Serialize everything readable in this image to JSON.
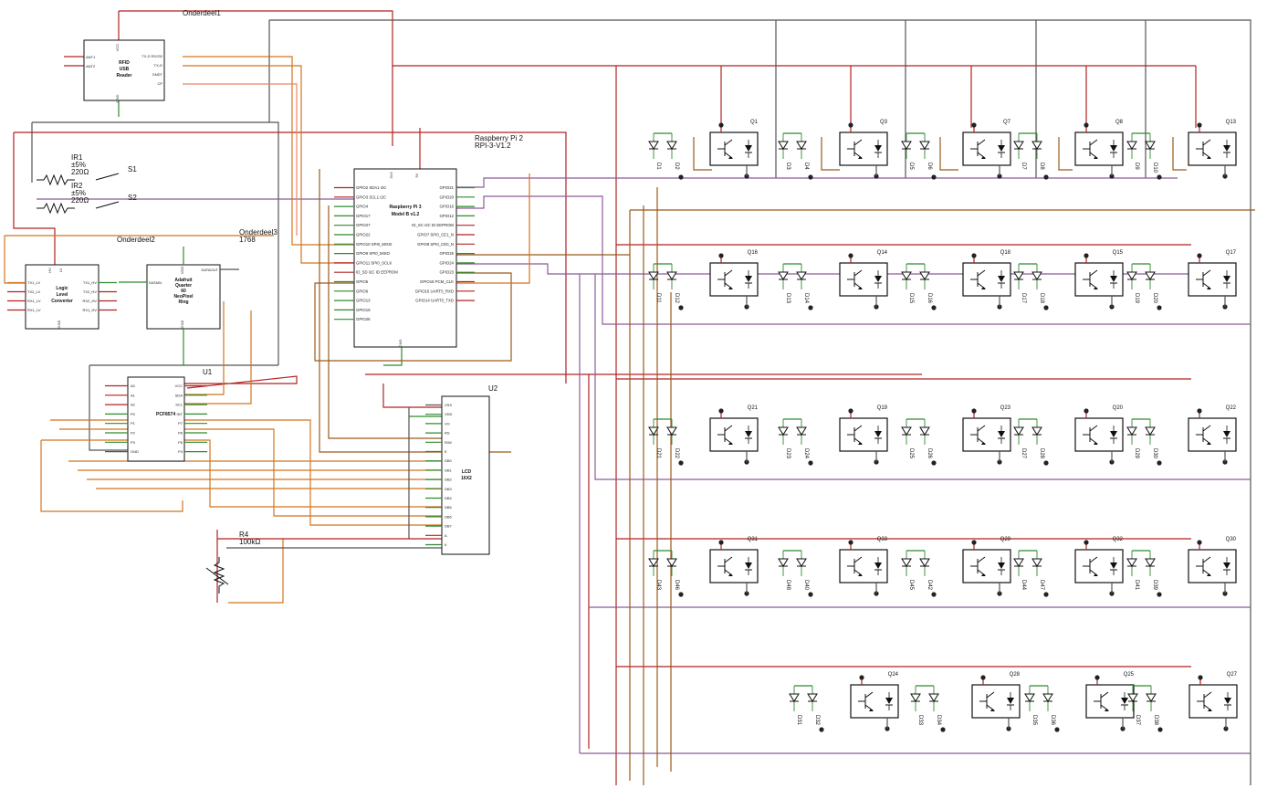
{
  "colors": {
    "red": "#b22222",
    "green": "#2e8b2e",
    "gray": "#555555",
    "brown": "#9a5a1c",
    "orange": "#d2751e",
    "purple": "#8e5b9a",
    "salmon": "#e8876a"
  },
  "labels": {
    "onderdeel1": "Onderdeel1",
    "onderdeel2": "Onderdeel2",
    "onderdeel3": "Onderdeel3",
    "onderdeel3_value": "1768",
    "rpi_title": "Raspberry Pi 2",
    "rpi_model": "RPI-3-V1.2",
    "u1": "U1",
    "u2": "U2",
    "ir1": "IR1",
    "ir2": "IR2",
    "tol": "±5%",
    "ohm": "220Ω",
    "s1": "S1",
    "s2": "S2",
    "r4": "R4",
    "r4_value": "100kΩ"
  },
  "chips": {
    "rfid": {
      "lines": [
        "RFID",
        "USB",
        "Reader"
      ],
      "vcc": "VCC",
      "gnd": "GND",
      "left_pins": [
        "ANT1",
        "ANT2"
      ],
      "right_pins": [
        "TX-D RX232",
        "TX-D",
        "GNDT",
        "CP"
      ]
    },
    "rpi": {
      "lines": [
        "Raspberry Pi 3",
        "Model B v1.2"
      ],
      "top_pins": [
        "3V3",
        "5V"
      ],
      "gnd": "GND",
      "left_pins": [
        "GPIO2 SDA1 I2C",
        "GPIO3 SCL1 I2C",
        "GPIO4",
        "GPIO17",
        "GPIO27",
        "GPIO22",
        "GPIO10 SPI0_MOSI",
        "GPIO9 SPI0_MISO",
        "GPIO11 SPI0_SCLK",
        "ID_SD I2C ID EEPROM",
        "GPIO5",
        "GPIO6",
        "GPIO13",
        "GPIO19",
        "GPIO26"
      ],
      "right_pins": [
        "GPIO21",
        "GPIO20",
        "GPIO16",
        "GPIO12",
        "ID_SC I2C ID EEPROM",
        "GPIO7 SPI0_CE1_N",
        "GPIO8 SPI0_CE0_N",
        "GPIO25",
        "GPIO24",
        "GPIO23",
        "GPIO18 PCM_CLK",
        "GPIO15 UART0_RXD",
        "GPIO14 UART0_TXD"
      ]
    },
    "llc": {
      "lines": [
        "Logic",
        "Level",
        "Converter"
      ],
      "top_pins": [
        "HV",
        "LV"
      ],
      "gnd": "GND",
      "left_pins": [
        "TX1_LV",
        "TX2_LV",
        "RX1_LV",
        "RX1_LV"
      ],
      "right_pins": [
        "TX1_HV",
        "TX2_HV",
        "RX2_HV",
        "RX1_HV"
      ]
    },
    "neo": {
      "lines": [
        "Adafruit",
        "Quarter",
        "60",
        "NeoPixel",
        "Ring"
      ],
      "vcc": "VDD",
      "gnd": "GND",
      "din": "DATAIN",
      "dout": "DATAOUT"
    },
    "pcf": {
      "lines": [
        "PCF8574"
      ],
      "left_pins": [
        "A0",
        "A1",
        "A2",
        "P0",
        "P1",
        "P2",
        "P3",
        "GND"
      ],
      "right_pins": [
        "VCC",
        "SDA",
        "SCL",
        "INT",
        "P7",
        "P6",
        "P5",
        "P4"
      ]
    },
    "lcd": {
      "lines": [
        "LCD",
        "16X2"
      ],
      "pins": [
        "VSS",
        "VDD",
        "VO",
        "RS",
        "R/W",
        "E",
        "DB0",
        "DB1",
        "DB2",
        "DB3",
        "DB4",
        "DB5",
        "DB6",
        "DB7",
        "A",
        "K"
      ]
    }
  },
  "transistor_rows": [
    [
      "Q1",
      "Q3",
      "Q7",
      "Q8",
      "Q13"
    ],
    [
      "Q16",
      "Q14",
      "Q18",
      "Q15",
      "Q17"
    ],
    [
      "Q21",
      "Q19",
      "Q23",
      "Q20",
      "Q22"
    ],
    [
      "Q31",
      "Q33",
      "Q29",
      "Q32",
      "Q30"
    ],
    [
      "Q24",
      "Q28",
      "Q25",
      "Q27"
    ]
  ],
  "diode_rows": [
    [
      "D1",
      "D2",
      "D3",
      "D4",
      "D5",
      "D6",
      "D7",
      "D8",
      "D9",
      "D10"
    ],
    [
      "D11",
      "D12",
      "D13",
      "D14",
      "D15",
      "D16",
      "D17",
      "D18",
      "D19",
      "D20"
    ],
    [
      "D21",
      "D22",
      "D23",
      "D24",
      "D25",
      "D26",
      "D27",
      "D28",
      "D29",
      "D30"
    ],
    [
      "D43",
      "D46",
      "D48",
      "D40",
      "D45",
      "D42",
      "D44",
      "D47",
      "D41",
      "D39"
    ],
    [
      "D31",
      "D32",
      "D33",
      "D34",
      "D35",
      "D36",
      "D37",
      "D38"
    ]
  ]
}
